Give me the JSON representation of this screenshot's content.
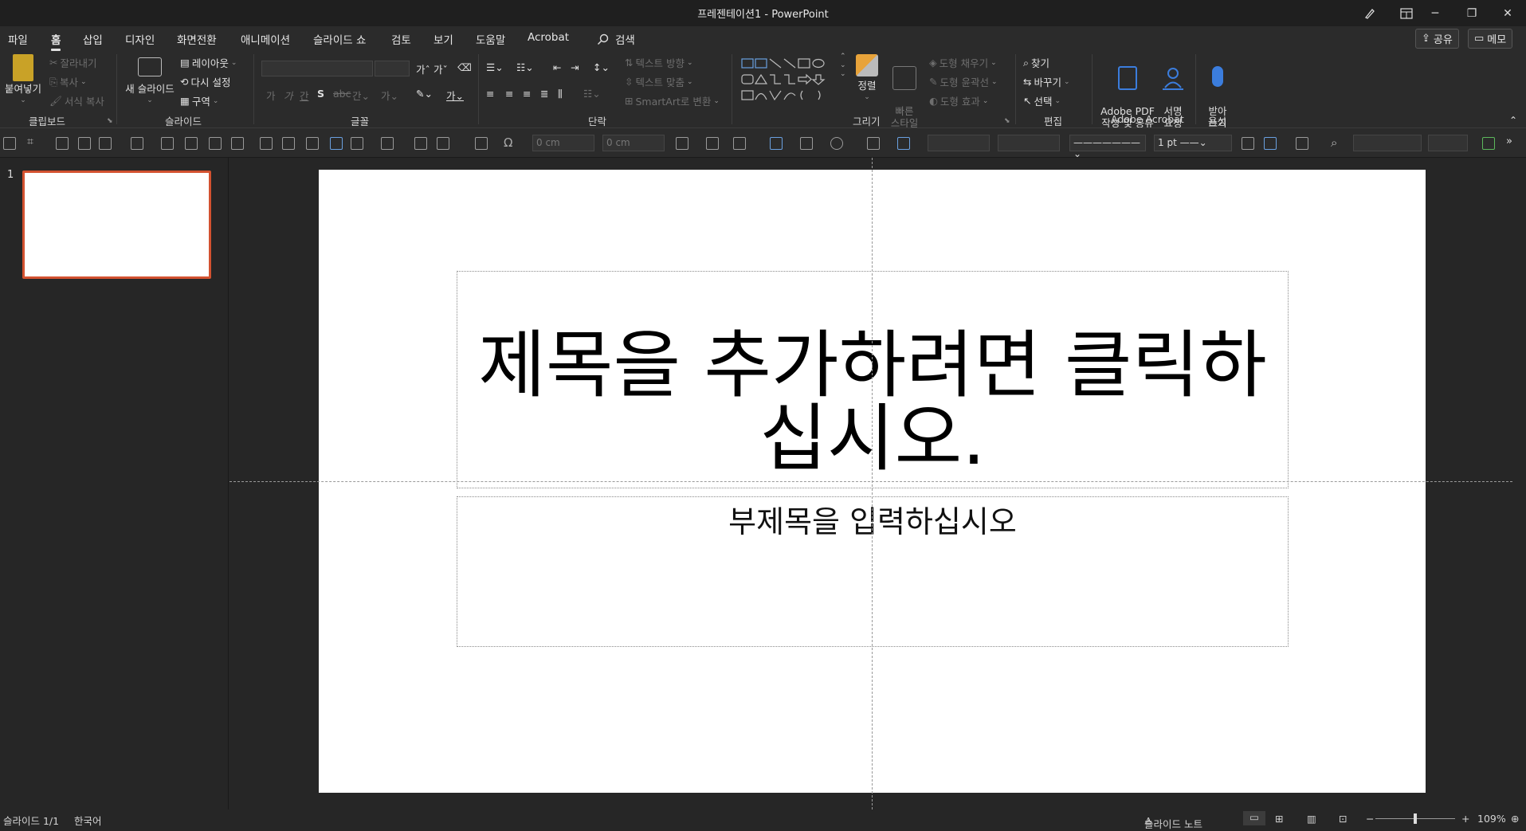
{
  "window": {
    "title": "프레젠테이션1  -  PowerPoint"
  },
  "tabs": [
    {
      "label": "파일"
    },
    {
      "label": "홈"
    },
    {
      "label": "삽입"
    },
    {
      "label": "디자인"
    },
    {
      "label": "화면전환"
    },
    {
      "label": "애니메이션"
    },
    {
      "label": "슬라이드 쇼"
    },
    {
      "label": "검토"
    },
    {
      "label": "보기"
    },
    {
      "label": "도움말"
    },
    {
      "label": "Acrobat"
    }
  ],
  "search": {
    "label": "검색"
  },
  "top_buttons": {
    "share": "공유",
    "comment": "메모"
  },
  "ribbon": {
    "clipboard": {
      "label": "클립보드",
      "paste": "붙여넣기",
      "cut": "잘라내기",
      "copy": "복사",
      "format_painter": "서식 복사"
    },
    "slides": {
      "label": "슬라이드",
      "new_slide": "새 슬라이드",
      "layout": "레이아웃",
      "reset": "다시 설정",
      "section": "구역"
    },
    "font": {
      "label": "글꼴"
    },
    "paragraph": {
      "label": "단락",
      "text_direction": "텍스트 방향",
      "align_text": "텍스트 맞춤",
      "smartart": "SmartArt로 변환"
    },
    "drawing": {
      "label": "그리기",
      "arrange": "정렬",
      "quick_styles": "빠른\n스타일",
      "shape_fill": "도형 채우기",
      "shape_outline": "도형 윤곽선",
      "shape_effects": "도형 효과"
    },
    "editing": {
      "label": "편집",
      "find": "찾기",
      "replace": "바꾸기",
      "select": "선택"
    },
    "acrobat": {
      "label": "Adobe Acrobat",
      "create_pdf": "Adobe PDF\n작성 및 공유",
      "request_sign": "서명\n요청"
    },
    "voice": {
      "label": "음성",
      "dictate": "받아\n쓰기"
    }
  },
  "toolbar2": {
    "width_placeholder": "0 cm",
    "height_placeholder": "0 cm",
    "line_weight": "1 pt"
  },
  "thumbnails": [
    {
      "number": "1"
    }
  ],
  "slide": {
    "title_placeholder": "제목을 추가하려면 클릭하십시오.",
    "subtitle_placeholder": "부제목을 입력하십시오"
  },
  "status": {
    "slide_count": "슬라이드 1/1",
    "language": "한국어",
    "notes": "슬라이드 노트",
    "zoom": "109%"
  },
  "colors": {
    "accent": "#d35230",
    "ribbon_bg": "#2b2b2b",
    "title_bg": "#1f1f1f",
    "acrobat_blue": "#3b7ddd"
  }
}
